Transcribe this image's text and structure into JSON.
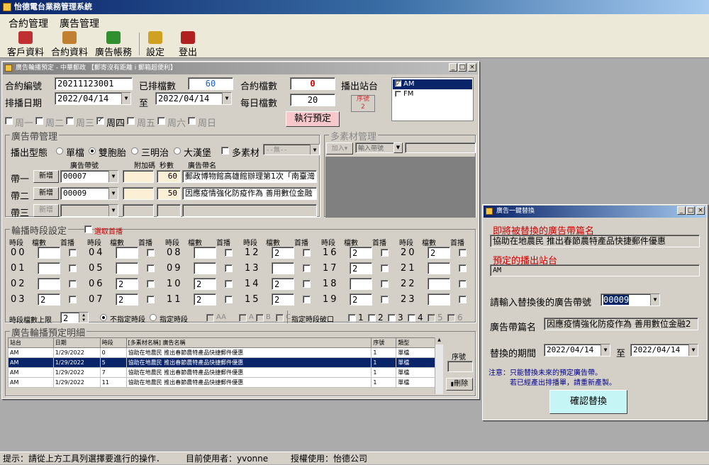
{
  "app": {
    "title": "怡德電台業務管理系統"
  },
  "menu": [
    "合約管理",
    "廣告管理"
  ],
  "toolbar": [
    {
      "label": "客戶資料",
      "icon": "customers-icon",
      "color": "#c03030"
    },
    {
      "label": "合約資料",
      "icon": "contract-icon",
      "color": "#c08030"
    },
    {
      "label": "廣告帳務",
      "icon": "money-icon",
      "color": "#309030"
    },
    {
      "label": "設定",
      "icon": "settings-icon",
      "color": "#d0a020"
    },
    {
      "label": "登出",
      "icon": "logout-icon",
      "color": "#b02020"
    }
  ],
  "booking": {
    "title": "廣告輪播預定 - 中華郵政 【郵寄沒有距離 i 郵箱超便利】",
    "contract_no_label": "合約編號",
    "contract_no": "20211123001",
    "scheduled_label": "已排檔數",
    "scheduled": "60",
    "contract_count_label": "合約檔數",
    "contract_count": "0",
    "station_label": "播出站台",
    "date_label": "排播日期",
    "date_from": "2022/04/14",
    "to_label": "至",
    "date_to": "2022/04/14",
    "daily_label": "每日檔數",
    "daily": "20",
    "seq_label": "序號",
    "seq": "2",
    "stations": [
      {
        "label": "AM",
        "checked": true
      },
      {
        "label": "FM",
        "checked": false
      }
    ],
    "weekdays": [
      {
        "label": "周一",
        "checked": false,
        "enabled": false
      },
      {
        "label": "周二",
        "checked": false,
        "enabled": false
      },
      {
        "label": "周三",
        "checked": false,
        "enabled": false
      },
      {
        "label": "周四",
        "checked": true,
        "enabled": true
      },
      {
        "label": "周五",
        "checked": false,
        "enabled": false
      },
      {
        "label": "周六",
        "checked": false,
        "enabled": false
      },
      {
        "label": "周日",
        "checked": false,
        "enabled": false
      }
    ],
    "execute_label": "執行預定",
    "band_group_label": "廣告帶管理",
    "play_type_label": "播出型態",
    "play_types": [
      {
        "label": "單檔",
        "on": false
      },
      {
        "label": "雙胞胎",
        "on": true
      },
      {
        "label": "三明治",
        "on": false
      },
      {
        "label": "大漢堡",
        "on": false
      }
    ],
    "multi_label": "多素材",
    "multi_select": "--無--",
    "multi_group_label": "多素材管理",
    "add_label": "加入▾",
    "input_band_label": "輸入帶號",
    "band_headers": [
      "廣告帶號",
      "附加碼",
      "秒數",
      "廣告帶名"
    ],
    "bands": [
      {
        "label": "帶一",
        "new_label": "新增",
        "no": "00007",
        "extra": "",
        "secs": "60",
        "name": "郵政博物館高雄館辦理第1次「南臺灣"
      },
      {
        "label": "帶二",
        "new_label": "新增",
        "no": "00009",
        "extra": "",
        "secs": "50",
        "name": "因應疫情強化防疫作為 善用數位金融"
      },
      {
        "label": "帶三",
        "new_label": "新增",
        "no": "",
        "extra": "",
        "secs": "",
        "name": ""
      }
    ],
    "slot_group_label": "輪播時段設定",
    "first_pick_label": "選取首播",
    "slot_headers": [
      "時段",
      "檔數",
      "首播"
    ],
    "slots": [
      {
        "h": "00",
        "c": ""
      },
      {
        "h": "01",
        "c": ""
      },
      {
        "h": "02",
        "c": ""
      },
      {
        "h": "03",
        "c": "2"
      },
      {
        "h": "04",
        "c": ""
      },
      {
        "h": "05",
        "c": ""
      },
      {
        "h": "06",
        "c": "2"
      },
      {
        "h": "07",
        "c": "2"
      },
      {
        "h": "08",
        "c": ""
      },
      {
        "h": "09",
        "c": ""
      },
      {
        "h": "10",
        "c": "2"
      },
      {
        "h": "11",
        "c": "2"
      },
      {
        "h": "12",
        "c": "2"
      },
      {
        "h": "13",
        "c": ""
      },
      {
        "h": "14",
        "c": "2"
      },
      {
        "h": "15",
        "c": "2"
      },
      {
        "h": "16",
        "c": "2"
      },
      {
        "h": "17",
        "c": "2"
      },
      {
        "h": "18",
        "c": ""
      },
      {
        "h": "19",
        "c": "2"
      },
      {
        "h": "20",
        "c": "2"
      },
      {
        "h": "21",
        "c": ""
      },
      {
        "h": "22",
        "c": ""
      },
      {
        "h": "23",
        "c": ""
      }
    ],
    "limit_label": "時段檔數上限",
    "limit": "2",
    "unspecified_label": "不指定時段",
    "specified_label": "指定時段",
    "zone_opts": [
      "AA",
      "A",
      "B",
      "C"
    ],
    "break_label": "指定時段破口",
    "breaks": [
      "1",
      "2",
      "3",
      "4",
      "5",
      "6"
    ],
    "detail_group_label": "廣告輪播預定明細",
    "detail_headers": [
      "站台",
      "日期",
      "時段",
      "[多素材名稱] 廣告名稱",
      "序號",
      "類型"
    ],
    "detail_rows": [
      [
        "AM",
        "1/29/2022",
        "0",
        "協助在地農民 推出春節農特產品快捷郵件優惠",
        "1",
        "單檔"
      ],
      [
        "AM",
        "1/29/2022",
        "5",
        "協助在地農民 推出春節農特產品快捷郵件優惠",
        "1",
        "單檔"
      ],
      [
        "AM",
        "1/29/2022",
        "7",
        "協助在地農民 推出春節農特產品快捷郵件優惠",
        "1",
        "單檔"
      ],
      [
        "AM",
        "1/29/2022",
        "11",
        "協助在地農民 推出春節農特產品快捷郵件優惠",
        "1",
        "單檔"
      ]
    ],
    "detail_seq_label": "序號",
    "delete_label": "刪除"
  },
  "replace": {
    "title": "廣告一鍵替換",
    "old_label": "即將被替換的廣告帶篇名",
    "old_value": "協助在地農民 推出春節農特產品快捷郵件優惠",
    "station_label": "預定的播出站台",
    "station_value": "AM",
    "new_no_label": "請輸入替換後的廣告帶號",
    "new_no": "00009",
    "name_label": "廣告帶篇名",
    "name_value": "因應疫情強化防疫作為 善用數位金融2",
    "period_label": "替換的期間",
    "from": "2022/04/14",
    "to_label": "至",
    "to": "2022/04/14",
    "note1": "注意：只能替換未來的預定廣告帶。",
    "note2": "若已經產出排播單，請重新產製。",
    "confirm_label": "確認替換"
  },
  "status": {
    "hint": "提示：請從上方工具列選擇要進行的操作．",
    "user": "目前使用者：yvonne",
    "license": "授權使用：怡德公司"
  }
}
